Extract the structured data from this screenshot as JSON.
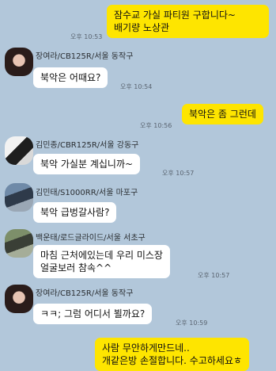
{
  "messages": {
    "m1": {
      "lines": [
        "잠수교 가실 파티원 구합니다~",
        "배기량 노상관"
      ],
      "time": "오후 10:53"
    },
    "m2": {
      "sender": "장여라/CB125R/서울 동작구",
      "text": "북악은 어때요?",
      "time": "오후 10:54"
    },
    "m3": {
      "text": "북악은 좀 그런데",
      "time": "오후 10:56"
    },
    "m4": {
      "sender": "김민종/CBR125R/서울 강동구",
      "text": "북악 가실분 계십니까~",
      "time": "오후 10:57"
    },
    "m5": {
      "sender": "김민태/S1000RR/서울 마포구",
      "text": "북악 급벙갈사람?"
    },
    "m6": {
      "sender": "백운태/로드글라이드/서울 서초구",
      "lines": [
        "마침 근처에있는데 우리 미스장",
        "얼굴보러 참속^^"
      ],
      "time": "오후 10:57"
    },
    "m7": {
      "sender": "장여라/CB125R/서울 동작구",
      "text": "ㅋㅋ; 그럼 어디서 뵐까요?",
      "time": "오후 10:59"
    },
    "m8": {
      "lines": [
        "사람 무안하게만드네..",
        "개같은방 손절합니다. 수고하세요ㅎ"
      ]
    }
  },
  "colors": {
    "background": "#b2c7da",
    "my_bubble": "#fee500",
    "other_bubble": "#ffffff"
  }
}
